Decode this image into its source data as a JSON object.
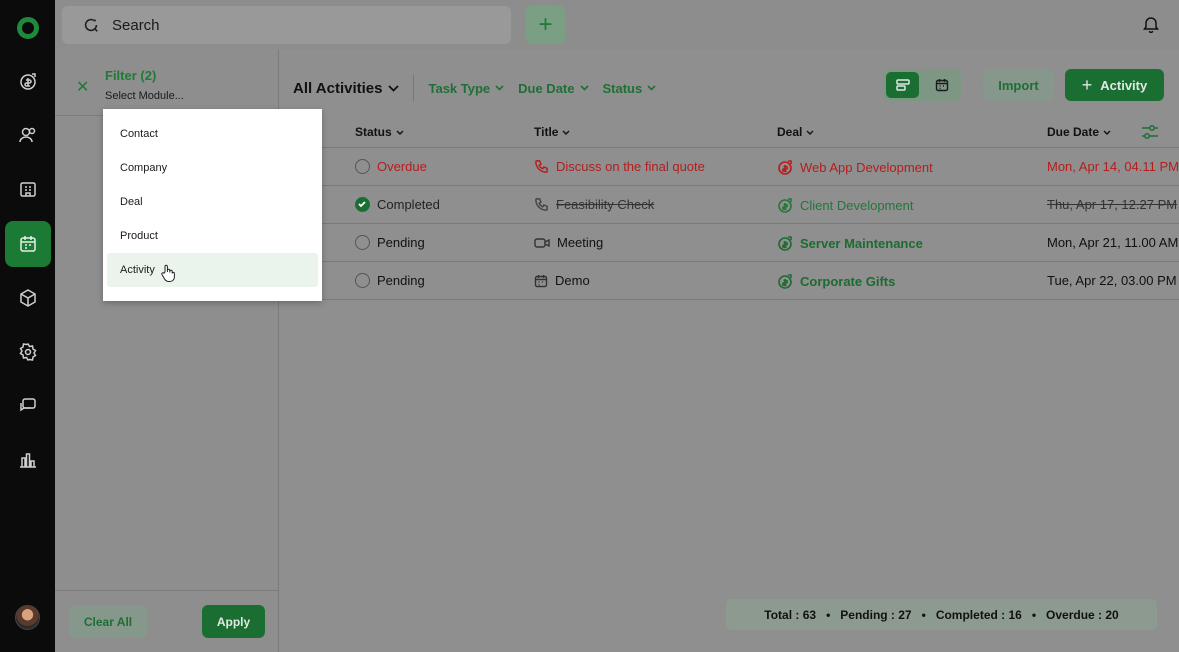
{
  "search": {
    "placeholder": "Search"
  },
  "filter": {
    "title": "Filter (2)",
    "module_placeholder": "Select Module...",
    "clear_label": "Clear All",
    "apply_label": "Apply"
  },
  "dropdown": {
    "items": [
      "Contact",
      "Company",
      "Deal",
      "Product",
      "Activity"
    ],
    "hovered": "Activity"
  },
  "toolbar": {
    "view_title": "All Activities",
    "filters": [
      "Task Type",
      "Due Date",
      "Status"
    ],
    "import_label": "Import",
    "activity_label": "Activity"
  },
  "table": {
    "columns": [
      "Status",
      "Title",
      "Deal",
      "Due Date"
    ],
    "rows": [
      {
        "status": "Overdue",
        "title": "Discuss on the final quote",
        "deal": "Web App Development",
        "due": "Mon, Apr 14, 04.11 PM",
        "task_icon": "phone-icon"
      },
      {
        "status": "Completed",
        "title": "Feasibility Check",
        "deal": "Client Development",
        "due": "Thu, Apr 17, 12.27 PM",
        "task_icon": "phone-icon"
      },
      {
        "status": "Pending",
        "title": "Meeting",
        "deal": "Server Maintenance",
        "due": "Mon, Apr 21, 11.00 AM",
        "task_icon": "video-icon"
      },
      {
        "status": "Pending",
        "title": "Demo",
        "deal": "Corporate Gifts",
        "due": "Tue, Apr 22, 03.00 PM",
        "task_icon": "calendar-icon"
      }
    ]
  },
  "summary": {
    "total": "Total : 63",
    "pending": "Pending : 27",
    "completed": "Completed : 16",
    "overdue": "Overdue : 20"
  },
  "colors": {
    "brand": "#1b6e32",
    "overdue": "#b51d1d",
    "rail": "#0b0b0b"
  }
}
